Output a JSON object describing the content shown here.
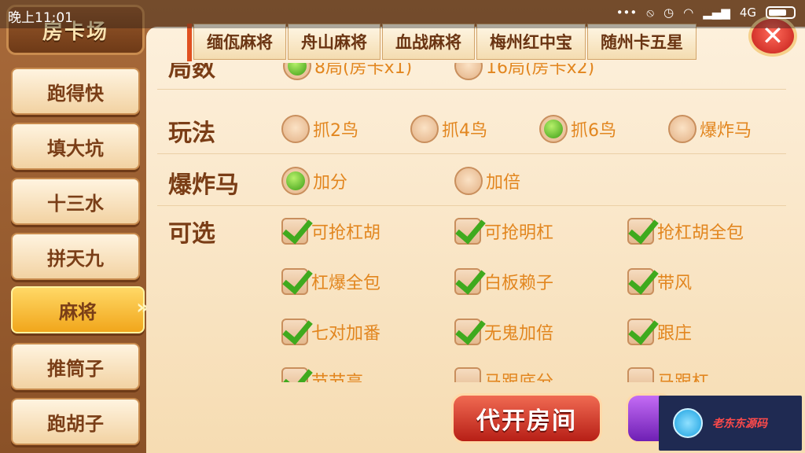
{
  "status": {
    "time": "晚上11:01",
    "signal": "4G"
  },
  "header": {
    "title": "房卡场"
  },
  "sidebar": {
    "items": [
      {
        "label": "跑得快"
      },
      {
        "label": "填大坑"
      },
      {
        "label": "十三水"
      },
      {
        "label": "拼天九"
      },
      {
        "label": "麻将",
        "active": true
      },
      {
        "label": "推筒子"
      },
      {
        "label": "跑胡子"
      }
    ]
  },
  "tabs": [
    {
      "label": "缅佤麻将"
    },
    {
      "label": "舟山麻将"
    },
    {
      "label": "血战麻将"
    },
    {
      "label": "梅州红中宝"
    },
    {
      "label": "随州卡五星"
    }
  ],
  "settings": {
    "rounds": {
      "label": "局数",
      "options": [
        "8局(房卡x1)",
        "16局(房卡x2)"
      ],
      "selected": 0
    },
    "play": {
      "label": "玩法",
      "options": [
        "抓2鸟",
        "抓4鸟",
        "抓6鸟",
        "爆炸马"
      ],
      "selected": 2
    },
    "bomb": {
      "label": "爆炸马",
      "options": [
        "加分",
        "加倍"
      ],
      "selected": 0
    },
    "optional": {
      "label": "可选",
      "items": [
        {
          "label": "可抢杠胡",
          "checked": true
        },
        {
          "label": "可抢明杠",
          "checked": true
        },
        {
          "label": "抢杠胡全包",
          "checked": true
        },
        {
          "label": "杠爆全包",
          "checked": true
        },
        {
          "label": "白板赖子",
          "checked": true
        },
        {
          "label": "带风",
          "checked": true
        },
        {
          "label": "七对加番",
          "checked": true
        },
        {
          "label": "无鬼加倍",
          "checked": true
        },
        {
          "label": "跟庄",
          "checked": true
        },
        {
          "label": "节节高",
          "checked": true
        },
        {
          "label": "马跟底分",
          "checked": false
        },
        {
          "label": "马跟杠",
          "checked": false
        }
      ]
    }
  },
  "actions": {
    "open_for_others": "代开房间"
  },
  "watermark": {
    "text": "老东东源码"
  },
  "colors": {
    "accent": "#f1a61b",
    "option_text": "#e2861f",
    "label_text": "#7a3d16",
    "action_red": "#b71f16"
  }
}
